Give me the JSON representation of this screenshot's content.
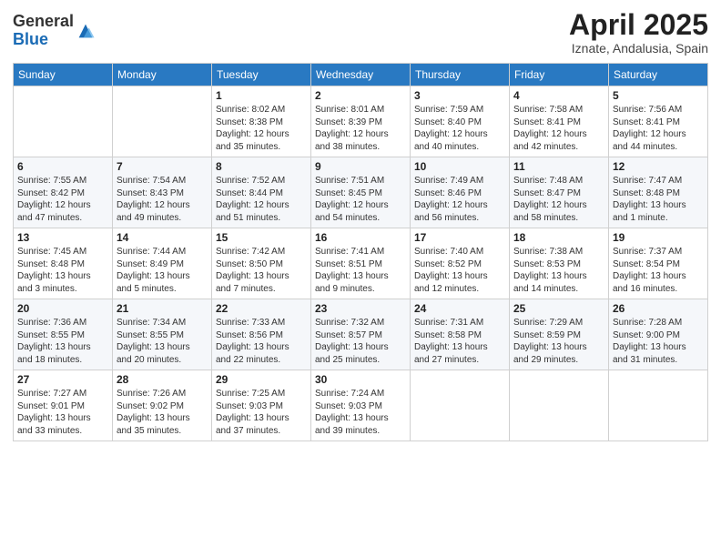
{
  "header": {
    "logo_general": "General",
    "logo_blue": "Blue",
    "title": "April 2025",
    "subtitle": "Iznate, Andalusia, Spain"
  },
  "calendar": {
    "days_of_week": [
      "Sunday",
      "Monday",
      "Tuesday",
      "Wednesday",
      "Thursday",
      "Friday",
      "Saturday"
    ],
    "weeks": [
      [
        {
          "day": "",
          "info": ""
        },
        {
          "day": "",
          "info": ""
        },
        {
          "day": "1",
          "info": "Sunrise: 8:02 AM\nSunset: 8:38 PM\nDaylight: 12 hours and 35 minutes."
        },
        {
          "day": "2",
          "info": "Sunrise: 8:01 AM\nSunset: 8:39 PM\nDaylight: 12 hours and 38 minutes."
        },
        {
          "day": "3",
          "info": "Sunrise: 7:59 AM\nSunset: 8:40 PM\nDaylight: 12 hours and 40 minutes."
        },
        {
          "day": "4",
          "info": "Sunrise: 7:58 AM\nSunset: 8:41 PM\nDaylight: 12 hours and 42 minutes."
        },
        {
          "day": "5",
          "info": "Sunrise: 7:56 AM\nSunset: 8:41 PM\nDaylight: 12 hours and 44 minutes."
        }
      ],
      [
        {
          "day": "6",
          "info": "Sunrise: 7:55 AM\nSunset: 8:42 PM\nDaylight: 12 hours and 47 minutes."
        },
        {
          "day": "7",
          "info": "Sunrise: 7:54 AM\nSunset: 8:43 PM\nDaylight: 12 hours and 49 minutes."
        },
        {
          "day": "8",
          "info": "Sunrise: 7:52 AM\nSunset: 8:44 PM\nDaylight: 12 hours and 51 minutes."
        },
        {
          "day": "9",
          "info": "Sunrise: 7:51 AM\nSunset: 8:45 PM\nDaylight: 12 hours and 54 minutes."
        },
        {
          "day": "10",
          "info": "Sunrise: 7:49 AM\nSunset: 8:46 PM\nDaylight: 12 hours and 56 minutes."
        },
        {
          "day": "11",
          "info": "Sunrise: 7:48 AM\nSunset: 8:47 PM\nDaylight: 12 hours and 58 minutes."
        },
        {
          "day": "12",
          "info": "Sunrise: 7:47 AM\nSunset: 8:48 PM\nDaylight: 13 hours and 1 minute."
        }
      ],
      [
        {
          "day": "13",
          "info": "Sunrise: 7:45 AM\nSunset: 8:48 PM\nDaylight: 13 hours and 3 minutes."
        },
        {
          "day": "14",
          "info": "Sunrise: 7:44 AM\nSunset: 8:49 PM\nDaylight: 13 hours and 5 minutes."
        },
        {
          "day": "15",
          "info": "Sunrise: 7:42 AM\nSunset: 8:50 PM\nDaylight: 13 hours and 7 minutes."
        },
        {
          "day": "16",
          "info": "Sunrise: 7:41 AM\nSunset: 8:51 PM\nDaylight: 13 hours and 9 minutes."
        },
        {
          "day": "17",
          "info": "Sunrise: 7:40 AM\nSunset: 8:52 PM\nDaylight: 13 hours and 12 minutes."
        },
        {
          "day": "18",
          "info": "Sunrise: 7:38 AM\nSunset: 8:53 PM\nDaylight: 13 hours and 14 minutes."
        },
        {
          "day": "19",
          "info": "Sunrise: 7:37 AM\nSunset: 8:54 PM\nDaylight: 13 hours and 16 minutes."
        }
      ],
      [
        {
          "day": "20",
          "info": "Sunrise: 7:36 AM\nSunset: 8:55 PM\nDaylight: 13 hours and 18 minutes."
        },
        {
          "day": "21",
          "info": "Sunrise: 7:34 AM\nSunset: 8:55 PM\nDaylight: 13 hours and 20 minutes."
        },
        {
          "day": "22",
          "info": "Sunrise: 7:33 AM\nSunset: 8:56 PM\nDaylight: 13 hours and 22 minutes."
        },
        {
          "day": "23",
          "info": "Sunrise: 7:32 AM\nSunset: 8:57 PM\nDaylight: 13 hours and 25 minutes."
        },
        {
          "day": "24",
          "info": "Sunrise: 7:31 AM\nSunset: 8:58 PM\nDaylight: 13 hours and 27 minutes."
        },
        {
          "day": "25",
          "info": "Sunrise: 7:29 AM\nSunset: 8:59 PM\nDaylight: 13 hours and 29 minutes."
        },
        {
          "day": "26",
          "info": "Sunrise: 7:28 AM\nSunset: 9:00 PM\nDaylight: 13 hours and 31 minutes."
        }
      ],
      [
        {
          "day": "27",
          "info": "Sunrise: 7:27 AM\nSunset: 9:01 PM\nDaylight: 13 hours and 33 minutes."
        },
        {
          "day": "28",
          "info": "Sunrise: 7:26 AM\nSunset: 9:02 PM\nDaylight: 13 hours and 35 minutes."
        },
        {
          "day": "29",
          "info": "Sunrise: 7:25 AM\nSunset: 9:03 PM\nDaylight: 13 hours and 37 minutes."
        },
        {
          "day": "30",
          "info": "Sunrise: 7:24 AM\nSunset: 9:03 PM\nDaylight: 13 hours and 39 minutes."
        },
        {
          "day": "",
          "info": ""
        },
        {
          "day": "",
          "info": ""
        },
        {
          "day": "",
          "info": ""
        }
      ]
    ]
  }
}
